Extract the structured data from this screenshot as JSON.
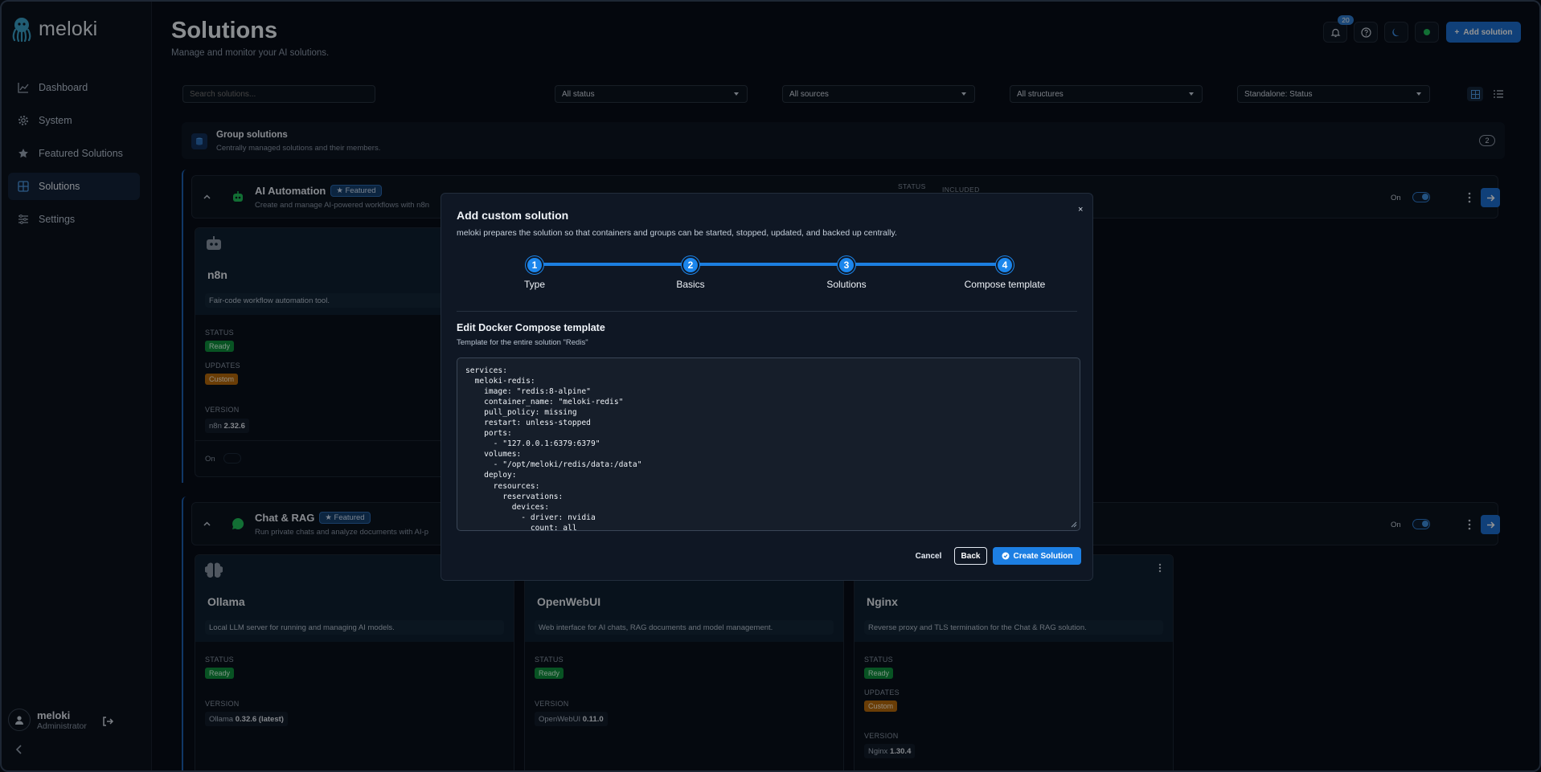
{
  "app": {
    "name": "meloki"
  },
  "sidebar": {
    "items": [
      {
        "label": "Dashboard",
        "icon": "chart-icon"
      },
      {
        "label": "System",
        "icon": "gear-icon"
      },
      {
        "label": "Featured Solutions",
        "icon": "star-icon"
      },
      {
        "label": "Solutions",
        "icon": "grid-icon",
        "active": true
      },
      {
        "label": "Settings",
        "icon": "sliders-icon"
      }
    ],
    "user": {
      "name": "meloki",
      "role": "Administrator"
    }
  },
  "header": {
    "title": "Solutions",
    "subtitle": "Manage and monitor your AI solutions.",
    "notifications_count": "20",
    "add_label": "Add solution"
  },
  "filters": {
    "search_placeholder": "Search solutions...",
    "status": "All status",
    "sources": "All sources",
    "structures": "All structures",
    "standalone": "Standalone: Status"
  },
  "group": {
    "title": "Group solutions",
    "desc": "Centrally managed solutions and their members.",
    "count": "2"
  },
  "sections": [
    {
      "title": "AI Automation",
      "badge": "Featured",
      "desc": "Create and manage AI-powered workflows with n8n",
      "col_status": "STATUS",
      "col_included": "INCLUDED",
      "on_label": "On",
      "cards": [
        {
          "name": "n8n",
          "desc": "Fair-code workflow automation tool.",
          "status_label": "STATUS",
          "status": "Ready",
          "updates_label": "UPDATES",
          "updates": "Custom",
          "version_label": "VERSION",
          "version_app": "n8n",
          "version": "2.32.6",
          "on_label": "On"
        }
      ]
    },
    {
      "title": "Chat & RAG",
      "badge": "Featured",
      "desc": "Run private chats and analyze documents with AI-p",
      "on_label": "On",
      "cards": [
        {
          "name": "Ollama",
          "desc": "Local LLM server for running and managing AI models.",
          "status_label": "STATUS",
          "status": "Ready",
          "version_label": "VERSION",
          "version_app": "Ollama",
          "version": "0.32.6 (latest)"
        },
        {
          "name": "OpenWebUI",
          "desc": "Web interface for AI chats, RAG documents and model management.",
          "status_label": "STATUS",
          "status": "Ready",
          "version_label": "VERSION",
          "version_app": "OpenWebUI",
          "version": "0.11.0"
        },
        {
          "name": "Nginx",
          "desc": "Reverse proxy and TLS termination for the Chat & RAG solution.",
          "status_label": "STATUS",
          "status": "Ready",
          "updates_label": "UPDATES",
          "updates": "Custom",
          "version_label": "VERSION",
          "version_app": "Nginx",
          "version": "1.30.4"
        }
      ]
    }
  ],
  "modal": {
    "title": "Add custom solution",
    "desc": "meloki prepares the solution so that containers and groups can be started, stopped, updated, and backed up centrally.",
    "close": "×",
    "steps": [
      {
        "num": "1",
        "label": "Type"
      },
      {
        "num": "2",
        "label": "Basics"
      },
      {
        "num": "3",
        "label": "Solutions"
      },
      {
        "num": "4",
        "label": "Compose template"
      }
    ],
    "section_title": "Edit Docker Compose template",
    "section_sub": "Template for the entire solution \"Redis\"",
    "template": "services:\n  meloki-redis:\n    image: \"redis:8-alpine\"\n    container_name: \"meloki-redis\"\n    pull_policy: missing\n    restart: unless-stopped\n    ports:\n      - \"127.0.0.1:6379:6379\"\n    volumes:\n      - \"/opt/meloki/redis/data:/data\"\n    deploy:\n      resources:\n        reservations:\n          devices:\n            - driver: nvidia\n              count: all",
    "cancel": "Cancel",
    "back": "Back",
    "create": "Create Solution"
  },
  "colors": {
    "accent": "#1d6fd1",
    "ready": "#0f8f3d",
    "custom": "#b76a0c",
    "bg": "#070d17"
  }
}
